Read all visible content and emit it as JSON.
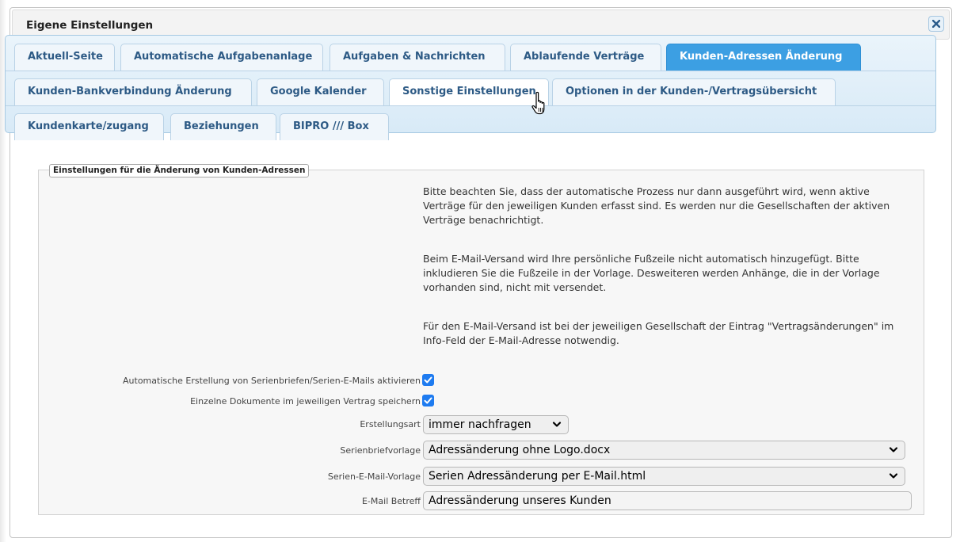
{
  "dialog": {
    "title": "Eigene Einstellungen",
    "close_icon": "close-icon"
  },
  "tabs": [
    {
      "label": "Aktuell-Seite",
      "state": "normal"
    },
    {
      "label": "Automatische Aufgabenanlage",
      "state": "normal"
    },
    {
      "label": "Aufgaben & Nachrichten",
      "state": "normal"
    },
    {
      "label": "Ablaufende Verträge",
      "state": "normal"
    },
    {
      "label": "Kunden-Adressen Änderung",
      "state": "active"
    },
    {
      "label": "Kunden-Bankverbindung Änderung",
      "state": "normal"
    },
    {
      "label": "Google Kalender",
      "state": "normal"
    },
    {
      "label": "Sonstige Einstellungen",
      "state": "hover"
    },
    {
      "label": "Optionen in der Kunden-/Vertragsübersicht",
      "state": "normal"
    },
    {
      "label": "Kundenkarte/zugang",
      "state": "normal"
    },
    {
      "label": "Beziehungen",
      "state": "normal"
    },
    {
      "label": "BIPRO /// Box",
      "state": "normal"
    }
  ],
  "section": {
    "legend": "Einstellungen für die Änderung von Kunden-Adressen",
    "info": [
      "Bitte beachten Sie, dass der automatische Prozess nur dann ausgeführt wird, wenn aktive Verträge für den jeweiligen Kunden erfasst sind. Es werden nur die Gesellschaften der aktiven Verträge benachrichtigt.",
      "Beim E-Mail-Versand wird Ihre persönliche Fußzeile nicht automatisch hinzugefügt. Bitte inkludieren Sie die Fußzeile in der Vorlage. Desweiteren werden Anhänge, die in der Vorlage vorhanden sind, nicht mit versendet.",
      "Für den E-Mail-Versand ist bei der jeweiligen Gesellschaft der Eintrag \"Vertragsänderungen\" im Info-Feld der E-Mail-Adresse notwendig."
    ]
  },
  "form": {
    "auto_serial": {
      "label": "Automatische Erstellung von Serienbriefen/Serien-E-Mails aktivieren",
      "checked": true
    },
    "save_docs": {
      "label": "Einzelne Dokumente im jeweiligen Vertrag speichern",
      "checked": true
    },
    "creation_type": {
      "label": "Erstellungsart",
      "value": "immer nachfragen"
    },
    "letter_template": {
      "label": "Serienbriefvorlage",
      "value": "Adressänderung ohne Logo.docx"
    },
    "email_template": {
      "label": "Serien-E-Mail-Vorlage",
      "value": "Serien Adressänderung per E-Mail.html"
    },
    "email_subject": {
      "label": "E-Mail Betreff",
      "value": "Adressänderung unseres Kunden"
    }
  },
  "colors": {
    "accent": "#3c9fe3",
    "tab_text": "#2d5a85",
    "checkbox": "#1e7bf0"
  }
}
